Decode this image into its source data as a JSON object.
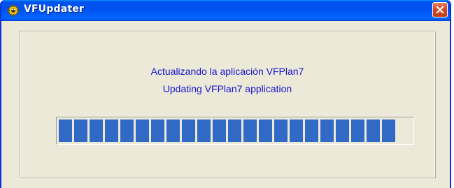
{
  "window": {
    "title": "VFUpdater",
    "close_symbol": "✕"
  },
  "icons": {
    "app": "gear-bug-app-icon",
    "close": "close-icon"
  },
  "messages": {
    "spanish": "Actualizando la aplicación VFPlan7",
    "english": "Updating VFPlan7 application"
  },
  "progress": {
    "value": 0.98,
    "segments_filled": 22
  },
  "colors": {
    "titlebar": "#0055ea",
    "client_bg": "#ece9d8",
    "message_text": "#1515d0",
    "progress_fill": "#3169c6",
    "close_button": "#d34a22"
  }
}
